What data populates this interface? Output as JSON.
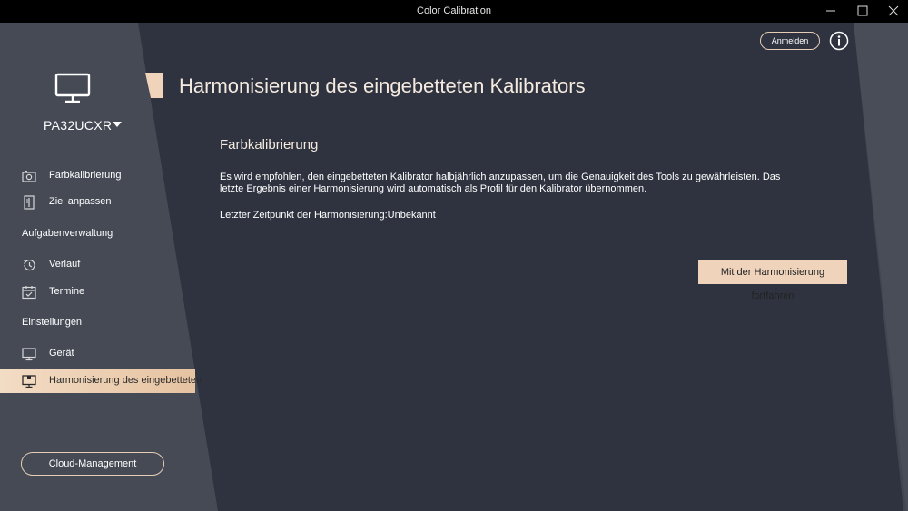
{
  "window": {
    "title": "Color Calibration"
  },
  "sidebar": {
    "device_name": "PA32UCXR",
    "items": [
      {
        "label": "Farbkalibrierung",
        "icon": "camera-icon"
      },
      {
        "label": "Ziel anpassen",
        "icon": "document-icon"
      }
    ],
    "section_tasks": "Aufgabenverwaltung",
    "task_items": [
      {
        "label": "Verlauf",
        "icon": "history-icon"
      },
      {
        "label": "Termine",
        "icon": "calendar-icon"
      }
    ],
    "section_settings": "Einstellungen",
    "settings_items": [
      {
        "label": "Gerät",
        "icon": "monitor-icon"
      },
      {
        "label": "Harmonisierung des eingebetteten",
        "icon": "calibrator-monitor-icon",
        "active": true
      }
    ],
    "cloud_button": "Cloud-Management"
  },
  "header": {
    "login_button": "Anmelden",
    "info_icon": "info-icon"
  },
  "main": {
    "page_title": "Harmonisierung des eingebetteten Kalibrators",
    "section_title": "Farbkalibrierung",
    "description": "Es wird empfohlen, den eingebetteten Kalibrator halbjährlich anzupassen, um die Genauigkeit des Tools zu gewährleisten. Das letzte Ergebnis einer Harmonisierung wird automatisch als Profil für den Kalibrator übernommen.",
    "last_time": "Letzter Zeitpunkt der Harmonisierung:Unbekannt",
    "continue_button": "Mit der Harmonisierung fortfahren"
  },
  "colors": {
    "background": "#2e333f",
    "sidebar": "#454a55",
    "accent": "#efd4bb",
    "titlebar": "#000000"
  }
}
